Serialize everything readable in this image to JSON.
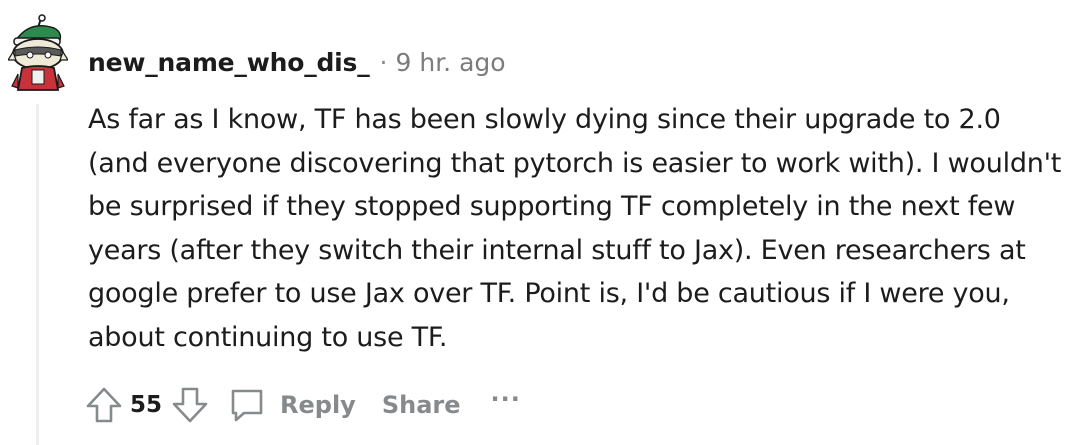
{
  "comment": {
    "author": "new_name_who_dis_",
    "separator": "·",
    "timestamp": "9 hr. ago",
    "body": "As far as I know, TF has been slowly dying since their upgrade to 2.0 (and everyone discovering that pytorch is easier to work with). I wouldn't be surprised if they stopped supporting TF completely in the next few years (after they switch their internal stuff to Jax). Even researchers at google prefer to use Jax over TF. Point is, I'd be cautious if I were you, about continuing to use TF.",
    "avatar_icon": "snoo-avatar-icon"
  },
  "actions": {
    "upvote_icon": "upvote-arrow-icon",
    "vote_count": "55",
    "downvote_icon": "downvote-arrow-icon",
    "reply_icon": "speech-bubble-icon",
    "reply_label": "Reply",
    "share_label": "Share",
    "more_label": "···"
  },
  "colors": {
    "text_primary": "#1c1c1c",
    "text_muted": "#878a8c",
    "thread_line": "#edeff1",
    "background": "#ffffff"
  }
}
